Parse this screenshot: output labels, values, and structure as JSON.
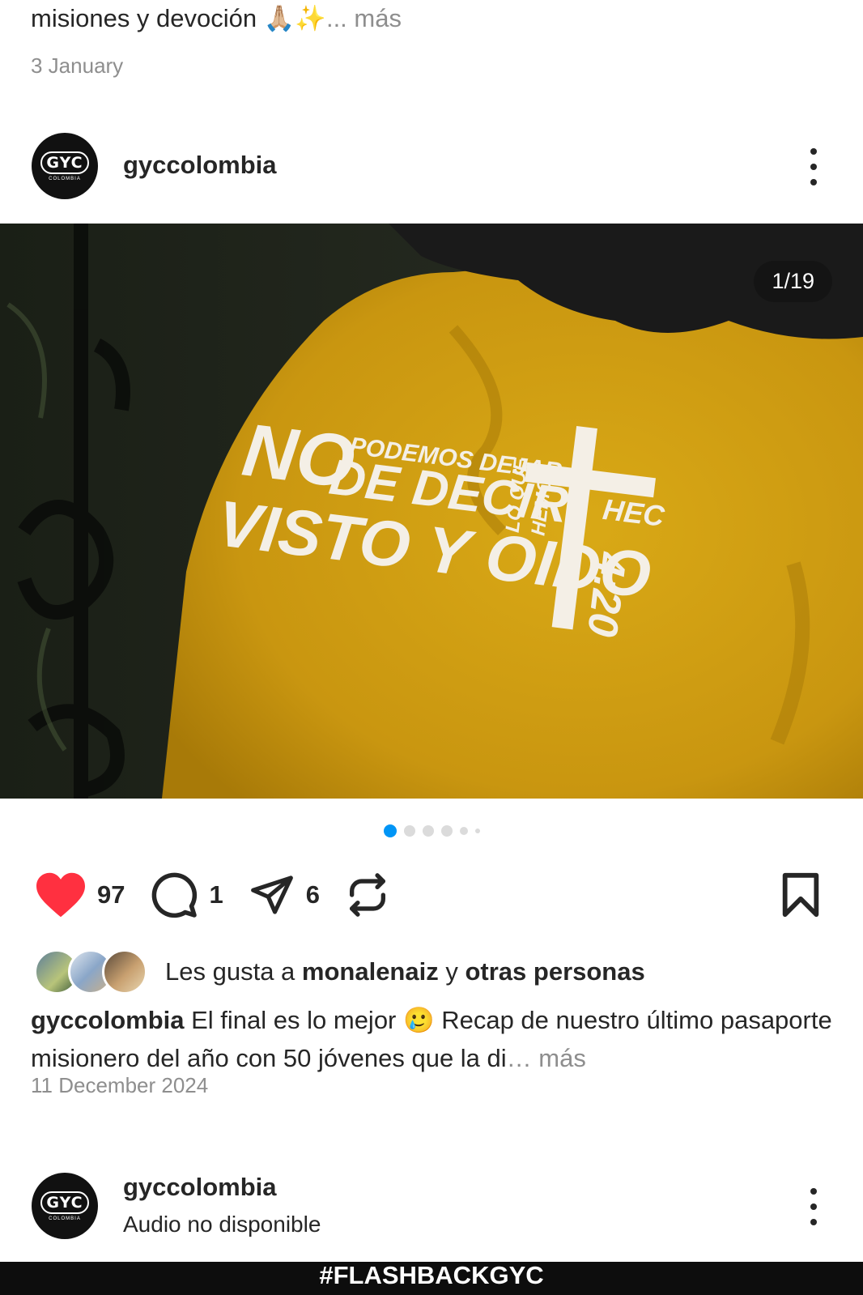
{
  "previous_post": {
    "caption_text": "misiones y devoción 🙏🏼✨",
    "more_label": "... más",
    "date": "3 January"
  },
  "post": {
    "username": "gyccolombia",
    "avatar_logo": "GYC",
    "avatar_sub": "COLOMBIA",
    "slide_counter": "1/19",
    "carousel": {
      "current": 1,
      "total": 19
    },
    "likes_count": "97",
    "comments_count": "1",
    "shares_count": "6",
    "liked_by_prefix": "Les gusta a ",
    "liked_by_user": "monalenaiz",
    "liked_by_join": " y ",
    "liked_by_others": "otras personas",
    "caption_user": "gyccolombia",
    "caption_text": " El final es lo mejor 🥲 Recap de nuestro último pasaporte misionero del año con 50 jóvenes que la di",
    "more_label": "… más",
    "date": "11 December 2024",
    "shirt_text": {
      "line1_big": "NO",
      "line1_small": "PODEMOS DEJAR",
      "line2": "DE DECIR",
      "side1": "LO QUE",
      "side2": "HEMOS",
      "line3": "VISTO Y OIDO",
      "ref1": "HEC",
      "ref2": "4:20"
    }
  },
  "next_post": {
    "username": "gyccolombia",
    "audio_status": "Audio no disponible",
    "banner_text": "#FLASHBACKGYC"
  },
  "colors": {
    "like_red": "#ff3040",
    "accent_blue": "#0095f6",
    "shirt_mustard": "#d19f12",
    "muted": "#8e8e8e"
  },
  "icons": {
    "like": "heart-icon",
    "comment": "comment-icon",
    "share": "send-icon",
    "repost": "repost-icon",
    "save": "bookmark-icon",
    "menu": "more-vertical-icon"
  }
}
